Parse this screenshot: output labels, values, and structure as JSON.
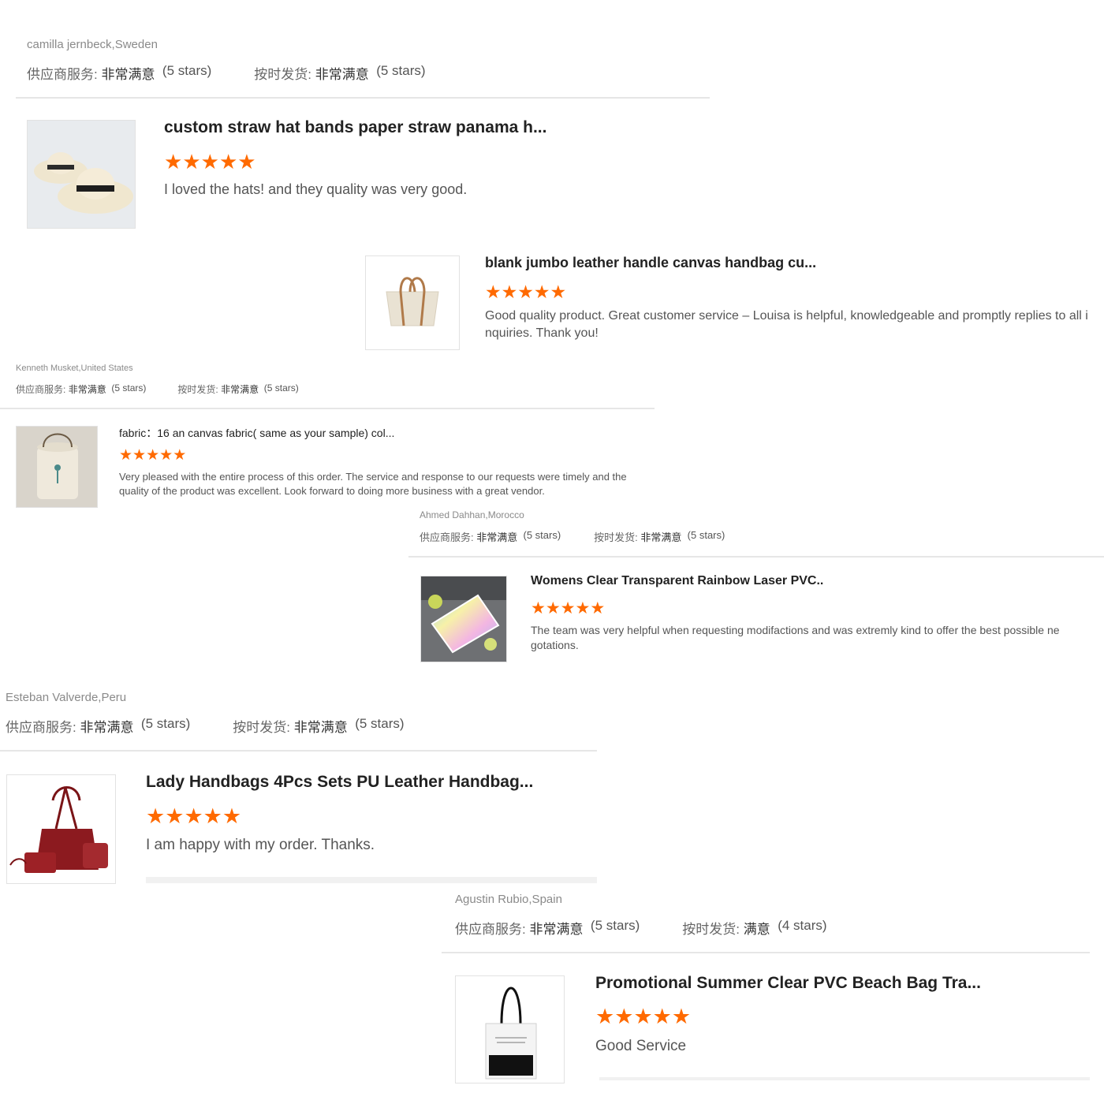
{
  "colors": {
    "star": "#ff6a00",
    "divider": "#e6e6e6",
    "reviewer": "#8a8a8a"
  },
  "labels": {
    "supplier_service": "供应商服务:",
    "on_time_shipment": "按时发货:"
  },
  "reviews": [
    {
      "reviewer": "camilla jernbeck,Sweden",
      "supplier_value": "非常满意",
      "supplier_stars": "(5 stars)",
      "shipment_value": "非常满意",
      "shipment_stars": "(5 stars)",
      "product_title": "custom straw hat bands paper straw panama h...",
      "rating": 5,
      "comment": "I loved the hats! and they quality was very good.",
      "image_icon": "straw-hat-image"
    },
    {
      "reviewer": "",
      "product_title": "blank jumbo leather handle canvas handbag cu...",
      "rating": 5,
      "comment": "Good quality product. Great customer service – Louisa is helpful, knowledgeable and promptly replies to all i nquiries. Thank you!",
      "image_icon": "canvas-handbag-image"
    },
    {
      "reviewer": "Kenneth Musket,United States",
      "supplier_value": "非常满意",
      "supplier_stars": "(5 stars)",
      "shipment_value": "非常满意",
      "shipment_stars": "(5 stars)",
      "product_title": "fabric：16 an canvas fabric( same as your sample) col...",
      "rating": 5,
      "comment": "Very pleased with the entire process of this order. The service and response to our requests were timely and the quality of the product was excellent. Look forward to doing more business with a great vendor.",
      "image_icon": "canvas-bucket-image"
    },
    {
      "reviewer": "Ahmed Dahhan,Morocco",
      "supplier_value": "非常满意",
      "supplier_stars": "(5 stars)",
      "shipment_value": "非常满意",
      "shipment_stars": "(5 stars)",
      "product_title": "Womens Clear Transparent Rainbow Laser PVC..",
      "rating": 5,
      "comment": "The team was very helpful when requesting modifactions and was extremly kind to offer the best possible ne gotations.",
      "image_icon": "holographic-pouch-image"
    },
    {
      "reviewer": "Esteban Valverde,Peru",
      "supplier_value": "非常满意",
      "supplier_stars": "(5 stars)",
      "shipment_value": "非常满意",
      "shipment_stars": "(5 stars)",
      "product_title": "Lady Handbags 4Pcs Sets PU Leather Handbag...",
      "rating": 5,
      "comment": "I am happy with my order. Thanks.",
      "image_icon": "red-handbag-set-image"
    },
    {
      "reviewer": "Agustin Rubio,Spain",
      "supplier_value": "非常满意",
      "supplier_stars": "(5 stars)",
      "shipment_value": "满意",
      "shipment_stars": "(4 stars)",
      "product_title": "Promotional Summer Clear PVC Beach Bag Tra...",
      "rating": 5,
      "comment": "Good Service",
      "image_icon": "clear-beach-bag-image"
    }
  ]
}
